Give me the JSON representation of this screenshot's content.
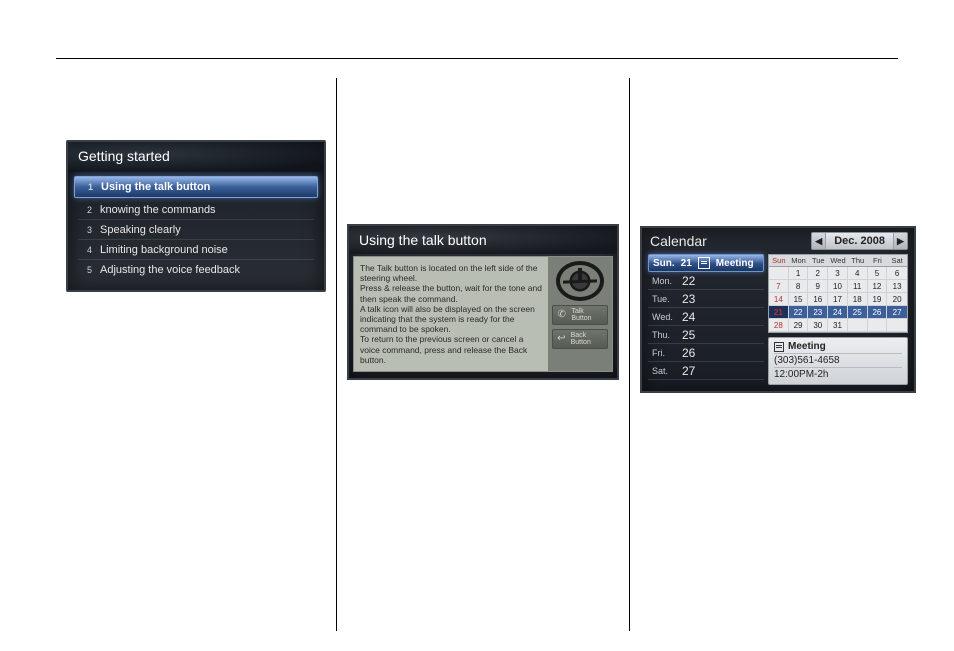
{
  "panel1": {
    "title": "Getting started",
    "items": [
      {
        "num": "1",
        "label": "Using the talk button",
        "selected": true
      },
      {
        "num": "2",
        "label": "knowing the commands"
      },
      {
        "num": "3",
        "label": "Speaking clearly"
      },
      {
        "num": "4",
        "label": "Limiting background noise"
      },
      {
        "num": "5",
        "label": "Adjusting the voice feedback"
      }
    ]
  },
  "panel2": {
    "title": "Using the talk button",
    "text": "The Talk button is located on the left side of the steering wheel.\nPress & release the button, wait for the tone and then speak the command.\nA talk icon will also be displayed on the screen indicating that the system is ready for the command to be spoken.\nTo return to the previous screen or cancel a voice command, press and release the Back button.",
    "side": {
      "talk": "Talk Button",
      "back": "Back Button"
    }
  },
  "panel3": {
    "title": "Calendar",
    "month": "Dec. 2008",
    "selected": {
      "dow": "Sun.",
      "day": "21",
      "evt": "Meeting"
    },
    "days": [
      {
        "dow": "Mon.",
        "day": "22"
      },
      {
        "dow": "Tue.",
        "day": "23"
      },
      {
        "dow": "Wed.",
        "day": "24"
      },
      {
        "dow": "Thu.",
        "day": "25"
      },
      {
        "dow": "Fri.",
        "day": "26"
      },
      {
        "dow": "Sat.",
        "day": "27"
      }
    ],
    "mini": {
      "heads": [
        "Sun",
        "Mon",
        "Tue",
        "Wed",
        "Thu",
        "Fri",
        "Sat"
      ],
      "cells": [
        "",
        "1",
        "2",
        "3",
        "4",
        "5",
        "6",
        "7",
        "8",
        "9",
        "10",
        "11",
        "12",
        "13",
        "14",
        "15",
        "16",
        "17",
        "18",
        "19",
        "20",
        "21",
        "22",
        "23",
        "24",
        "25",
        "26",
        "27",
        "28",
        "29",
        "30",
        "31",
        "",
        "",
        ""
      ],
      "selectedWeekStart": 21,
      "selectedDay": 21
    },
    "event": {
      "title": "Meeting",
      "phone": "(303)561-4658",
      "time": "12:00PM-2h"
    }
  }
}
